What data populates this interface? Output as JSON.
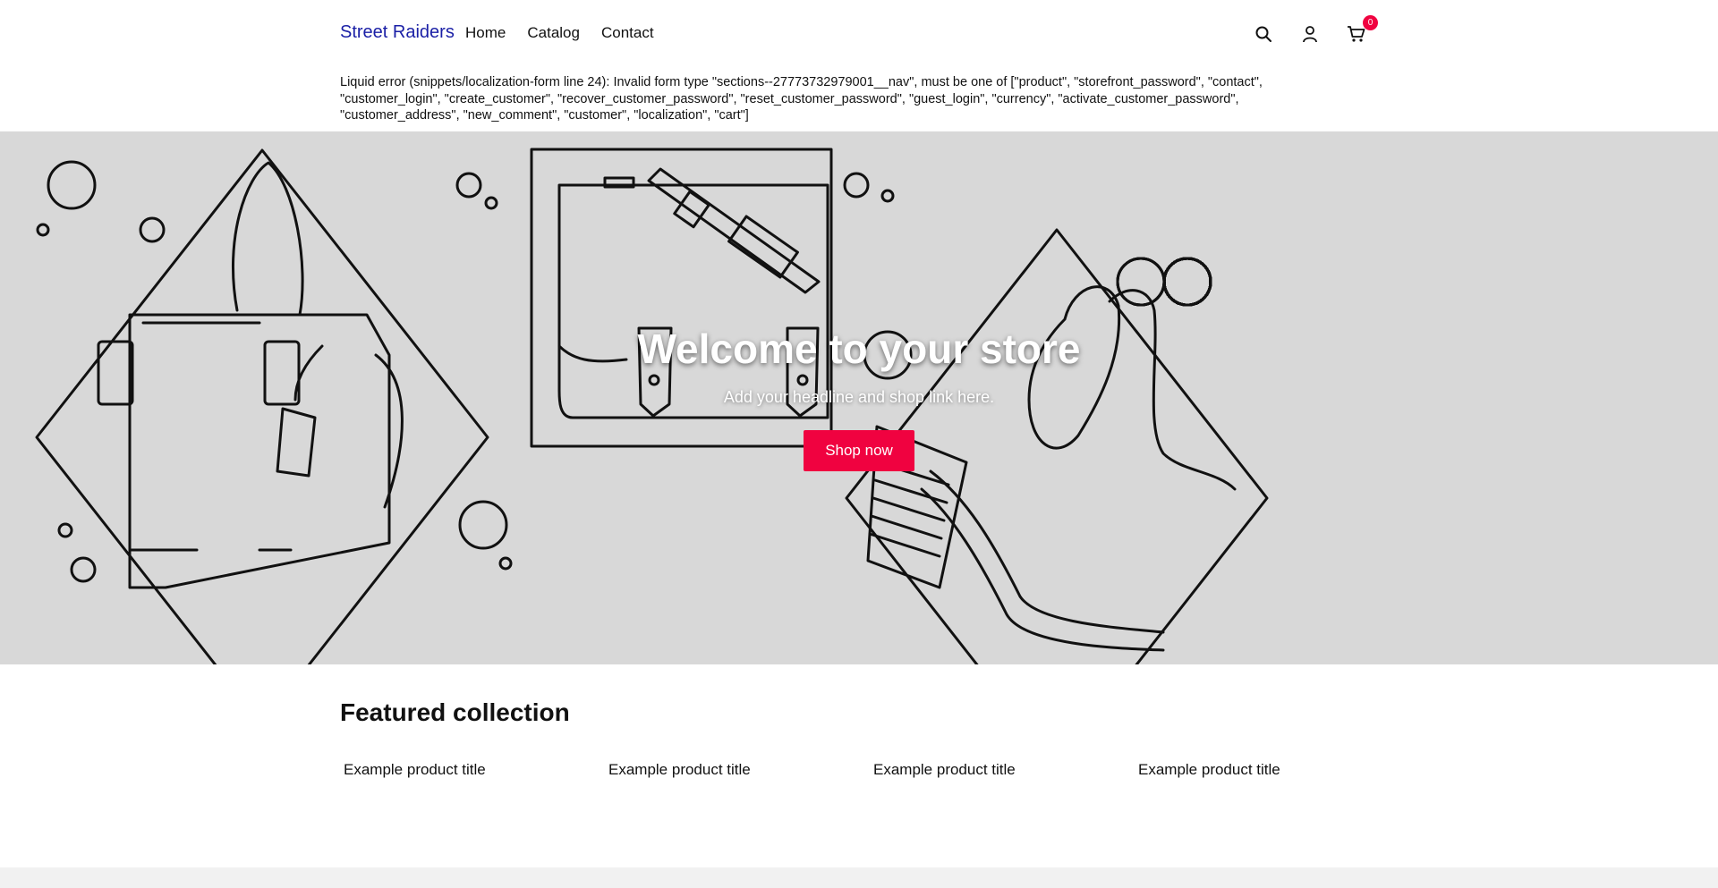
{
  "header": {
    "brand": "Street Raiders",
    "nav": [
      "Home",
      "Catalog",
      "Contact"
    ],
    "cart_count": "0",
    "icons": [
      "search-icon",
      "account-icon",
      "cart-icon"
    ]
  },
  "error": {
    "message": "Liquid error (snippets/localization-form line 24): Invalid form type \"sections--27773732979001__nav\", must be one of [\"product\", \"storefront_password\", \"contact\", \"customer_login\", \"create_customer\", \"recover_customer_password\", \"reset_customer_password\", \"guest_login\", \"currency\", \"activate_customer_password\", \"customer_address\", \"new_comment\", \"customer\", \"localization\", \"cart\"]"
  },
  "hero": {
    "title": "Welcome to your store",
    "subtitle": "Add your headline and shop link here.",
    "button": "Shop now",
    "background_color": "#d8d8d8",
    "button_color": "#f00240"
  },
  "featured": {
    "title": "Featured collection",
    "products": [
      "Example product title",
      "Example product title",
      "Example product title",
      "Example product title"
    ]
  },
  "colors": {
    "brand": "#1a1fa6",
    "accent": "#f00240"
  }
}
